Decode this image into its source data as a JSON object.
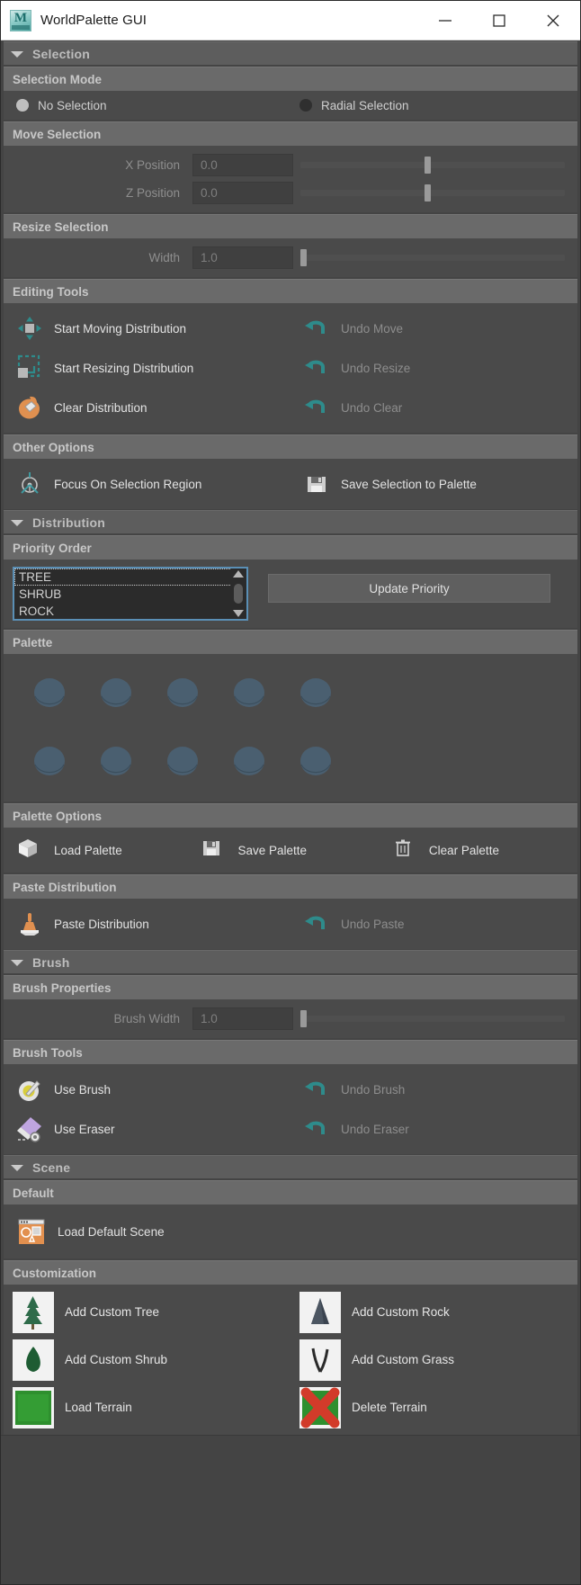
{
  "window": {
    "title": "WorldPalette GUI",
    "app_icon": "maya-m-icon",
    "minimize": "minimize-icon",
    "maximize": "maximize-icon",
    "close": "close-icon"
  },
  "frames": {
    "selection": "Selection",
    "distribution": "Distribution",
    "brush": "Brush",
    "scene": "Scene"
  },
  "selection": {
    "mode_section": "Selection Mode",
    "modes": [
      {
        "label": "No Selection",
        "selected": true
      },
      {
        "label": "Radial Selection",
        "selected": false
      }
    ],
    "move_section": "Move Selection",
    "fields": [
      {
        "label": "X Position",
        "value": "0.0",
        "slider_pct": 50
      },
      {
        "label": "Z Position",
        "value": "0.0",
        "slider_pct": 50
      }
    ],
    "resize_section": "Resize Selection",
    "resize_fields": [
      {
        "label": "Width",
        "value": "1.0",
        "slider_pct": 0
      }
    ],
    "editing_section": "Editing Tools",
    "editing_tools": [
      {
        "label": "Start Moving Distribution",
        "icon": "move-distribution-icon",
        "enabled": true
      },
      {
        "label": "Undo Move",
        "icon": "undo-arrow-icon",
        "enabled": false
      },
      {
        "label": "Start Resizing Distribution",
        "icon": "resize-distribution-icon",
        "enabled": true
      },
      {
        "label": "Undo Resize",
        "icon": "undo-arrow-icon",
        "enabled": false
      },
      {
        "label": "Clear Distribution",
        "icon": "clear-distribution-icon",
        "enabled": true
      },
      {
        "label": "Undo Clear",
        "icon": "undo-arrow-icon",
        "enabled": false
      }
    ],
    "other_section": "Other Options",
    "other_tools": [
      {
        "label": "Focus On Selection Region",
        "icon": "focus-target-icon",
        "enabled": true
      },
      {
        "label": "Save Selection to Palette",
        "icon": "floppy-save-icon",
        "enabled": true
      }
    ]
  },
  "distribution": {
    "priority_section": "Priority Order",
    "priority_items": [
      "TREE",
      "SHRUB",
      "ROCK"
    ],
    "priority_focused_index": 0,
    "update_button": "Update Priority",
    "palette_section": "Palette",
    "palette_swatch_color": "#4a5f70",
    "palette_rows": 2,
    "palette_cols": 5,
    "palette_options_section": "Palette Options",
    "palette_options": [
      {
        "label": "Load Palette",
        "icon": "cube-load-icon"
      },
      {
        "label": "Save Palette",
        "icon": "floppy-save-icon"
      },
      {
        "label": "Clear Palette",
        "icon": "trash-icon"
      }
    ],
    "paste_section": "Paste Distribution",
    "paste_tools": [
      {
        "label": "Paste Distribution",
        "icon": "stamp-icon",
        "enabled": true
      },
      {
        "label": "Undo Paste",
        "icon": "undo-arrow-icon",
        "enabled": false
      }
    ]
  },
  "brush": {
    "properties_section": "Brush Properties",
    "fields": [
      {
        "label": "Brush Width",
        "value": "1.0",
        "slider_pct": 0
      }
    ],
    "tools_section": "Brush Tools",
    "tools": [
      {
        "label": "Use Brush",
        "icon": "paint-brush-icon",
        "enabled": true
      },
      {
        "label": "Undo Brush",
        "icon": "undo-arrow-icon",
        "enabled": false
      },
      {
        "label": "Use Eraser",
        "icon": "eraser-icon",
        "enabled": true
      },
      {
        "label": "Undo Eraser",
        "icon": "undo-arrow-icon",
        "enabled": false
      }
    ]
  },
  "scene": {
    "default_section": "Default",
    "default_tools": [
      {
        "label": "Load Default Scene",
        "icon": "default-scene-icon"
      }
    ],
    "customization_section": "Customization",
    "customization": [
      {
        "label": "Add Custom Tree",
        "icon": "tree-thumbnail"
      },
      {
        "label": "Add Custom Rock",
        "icon": "rock-thumbnail"
      },
      {
        "label": "Add Custom Shrub",
        "icon": "shrub-thumbnail"
      },
      {
        "label": "Add Custom Grass",
        "icon": "grass-thumbnail"
      },
      {
        "label": "Load Terrain",
        "icon": "terrain-thumbnail"
      },
      {
        "label": "Delete Terrain",
        "icon": "delete-terrain-thumbnail"
      }
    ]
  },
  "colors": {
    "accent_teal": "#2e8b8b",
    "accent_orange": "#e09050",
    "listbox_border": "#5a8fb5",
    "panel_bg": "#4a4a4a",
    "section_bg": "#6a6a6a"
  }
}
